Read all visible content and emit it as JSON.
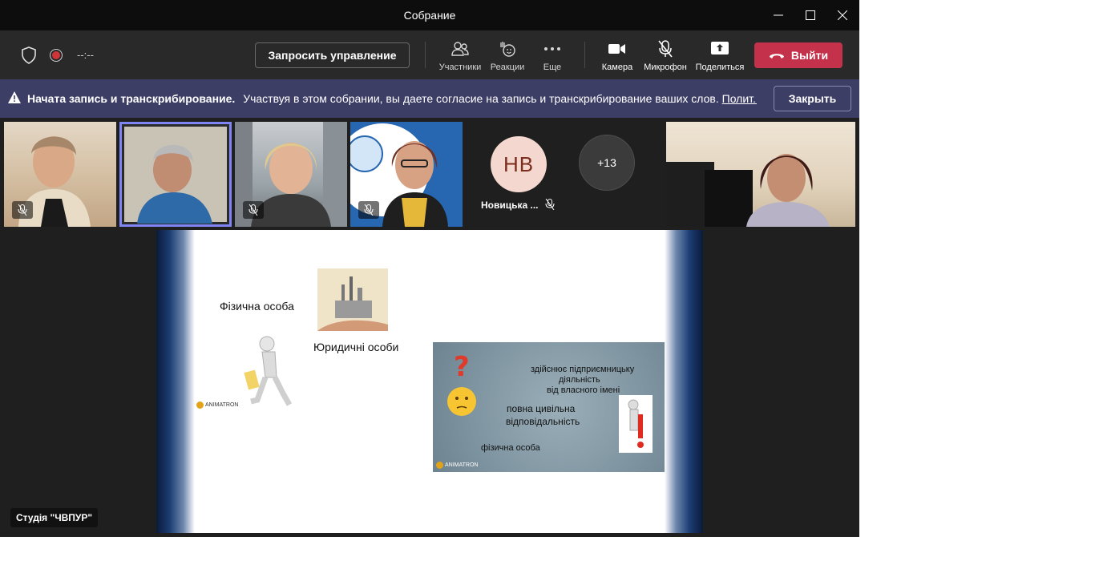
{
  "window": {
    "title": "Собрание"
  },
  "toolbar": {
    "timer": "--:--",
    "request_control": "Запросить управление",
    "participants": "Участники",
    "reactions": "Реакции",
    "more": "Еще",
    "camera": "Камера",
    "microphone": "Микрофон",
    "share": "Поделиться",
    "leave": "Выйти"
  },
  "banner": {
    "title": "Начата запись и транскрибирование.",
    "message": "Участвуя в этом собрании, вы даете согласие на запись и транскрибирование ваших слов.",
    "link": "Полит...",
    "close": "Закрыть"
  },
  "gallery": {
    "avatar_initials": "НВ",
    "avatar_name": "Новицька ...",
    "overflow_count": "+13"
  },
  "slide": {
    "person_label": "Фізична особа",
    "legal_label": "Юридичні особи",
    "logo_text": "ANIMATRON",
    "panel": {
      "line1": "здійснює підприємницьку",
      "line2": "діяльність",
      "line3": "від власного імені",
      "line4": "повна цивільна",
      "line5": "відповідальність",
      "line6": "фізична особа",
      "logo": "ANIMATRON"
    }
  },
  "presenter_label": "Студія \"ЧВПУР\"",
  "colors": {
    "leave": "#c4314b",
    "banner": "#3d3e66",
    "selected": "#7f85f5"
  }
}
